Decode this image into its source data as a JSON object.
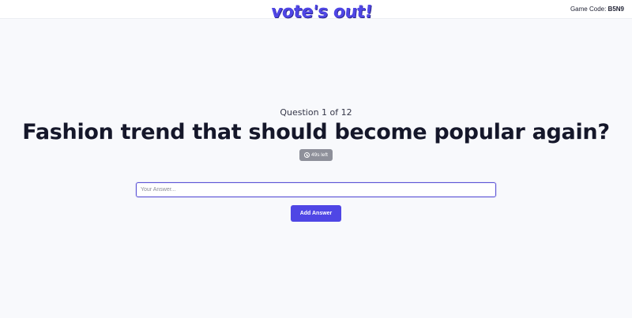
{
  "header": {
    "logo_text": "vote's out!",
    "game_code_label": "Game Code:",
    "game_code": "B5N9"
  },
  "question": {
    "counter": "Question 1 of 12",
    "title": "Fashion trend that should become popular again?",
    "timer_text": "49s left"
  },
  "answer_form": {
    "placeholder": "Your Answer...",
    "value": "",
    "submit_label": "Add Answer"
  },
  "colors": {
    "accent": "#4f46e5",
    "timer_badge": "#8e909a",
    "background": "#f8f9fc"
  },
  "icons": [
    "clock-icon"
  ]
}
